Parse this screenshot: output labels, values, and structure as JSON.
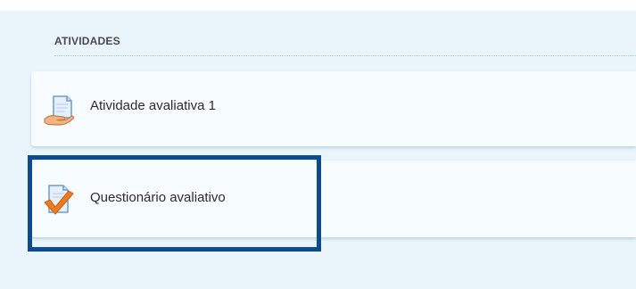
{
  "section": {
    "title": "ATIVIDADES"
  },
  "activities": [
    {
      "label": "Atividade avaliativa 1",
      "icon": "assignment-hand-icon"
    },
    {
      "label": "Questionário avaliativo",
      "icon": "quiz-check-icon"
    }
  ],
  "colors": {
    "panel_background": "#e9f5fb",
    "card_background": "#f6fcff",
    "highlight_border": "#0d4a94",
    "check_orange": "#f07a1c"
  }
}
